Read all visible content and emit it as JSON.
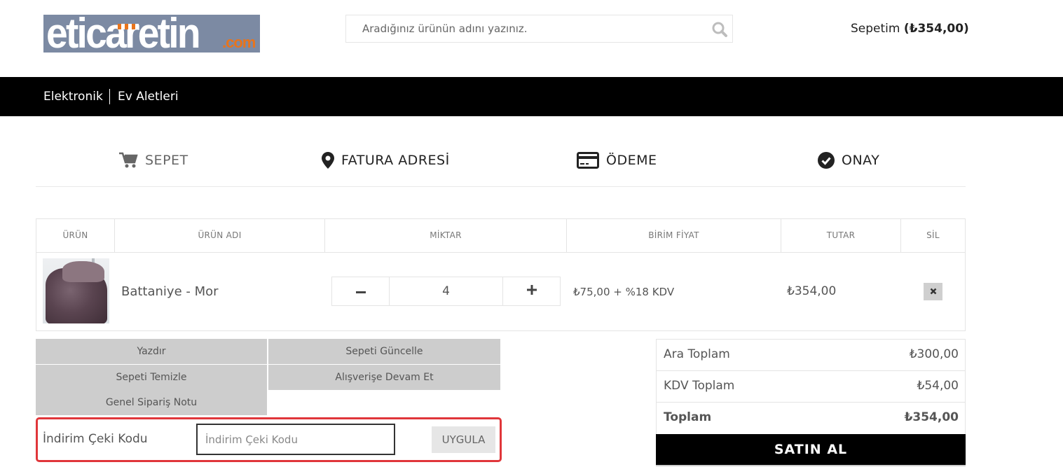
{
  "header": {
    "logo": {
      "text": "eticaretin",
      "suffix": ".com",
      "colors": {
        "background": "#7c8aa3",
        "text": "#ffffff",
        "accent": "#e8741c"
      }
    },
    "search": {
      "placeholder": "Aradığınız ürünün adını yazınız.",
      "icon": "search-icon"
    },
    "cart": {
      "label": "Sepetim",
      "total": "(₺354,00)"
    }
  },
  "nav": {
    "items": [
      {
        "label": "Elektronik"
      },
      {
        "label": "Ev Aletleri"
      }
    ]
  },
  "steps": [
    {
      "label": "SEPET",
      "icon": "cart-icon",
      "active": true
    },
    {
      "label": "FATURA ADRESİ",
      "icon": "map-pin-icon",
      "active": false
    },
    {
      "label": "ÖDEME",
      "icon": "credit-card-icon",
      "active": false
    },
    {
      "label": "ONAY",
      "icon": "check-circle-icon",
      "active": false
    }
  ],
  "cart_table": {
    "columns": [
      "ÜRÜN",
      "ÜRÜN ADI",
      "MİKTAR",
      "BİRİM FİYAT",
      "TUTAR",
      "SİL"
    ],
    "rows": [
      {
        "product_name": "Battaniye - Mor",
        "quantity": "4",
        "unit_price": "₺75,00 + %18 KDV",
        "total": "₺354,00",
        "remove_icon": "close-icon"
      }
    ]
  },
  "actions": {
    "print": "Yazdır",
    "update_cart": "Sepeti Güncelle",
    "clear_cart": "Sepeti Temizle",
    "continue_shopping": "Alışverişe Devam Et",
    "order_note": "Genel Sipariş Notu"
  },
  "coupon": {
    "label": "İndirim Çeki Kodu",
    "placeholder": "İndirim Çeki Kodu",
    "value": "",
    "apply_label": "UYGULA",
    "highlight_color": "#e0363a"
  },
  "totals": {
    "subtotal_label": "Ara Toplam",
    "subtotal_value": "₺300,00",
    "tax_label": "KDV Toplam",
    "tax_value": "₺54,00",
    "grand_label": "Toplam",
    "grand_value": "₺354,00",
    "buy_label": "SATIN AL"
  }
}
